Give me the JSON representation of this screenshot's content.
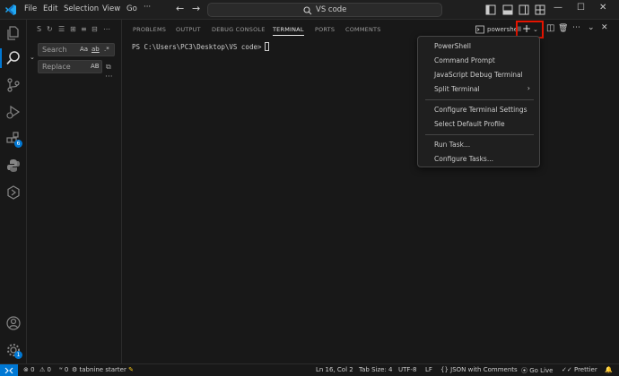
{
  "titlebar": {
    "menus": [
      "File",
      "Edit",
      "Selection",
      "View",
      "Go"
    ],
    "more": "···",
    "search_label": "VS code"
  },
  "activity": {
    "extensions_badge": "6",
    "manage_badge": "1"
  },
  "sidebar": {
    "search_placeholder": "Search",
    "search_case": "Aa",
    "search_word": "ab",
    "search_regex": ".*",
    "replace_placeholder": "Replace",
    "replace_case": "AB",
    "more": "···"
  },
  "panel": {
    "tabs": [
      "PROBLEMS",
      "OUTPUT",
      "DEBUG CONSOLE",
      "TERMINAL",
      "PORTS",
      "COMMENTS"
    ],
    "active_tab": "TERMINAL",
    "shell_label": "powershell",
    "prompt": "PS C:\\Users\\PC3\\Desktop\\VS code>"
  },
  "dropdown": {
    "items": [
      "PowerShell",
      "Command Prompt",
      "JavaScript Debug Terminal",
      "Split Terminal",
      "Configure Terminal Settings",
      "Select Default Profile",
      "Run Task...",
      "Configure Tasks..."
    ]
  },
  "statusbar": {
    "errors": "0",
    "warnings": "0",
    "ports": "0",
    "tabnine": "tabnine starter",
    "position": "Ln 16, Col 2",
    "tab_size": "Tab Size: 4",
    "encoding": "UTF-8",
    "eol": "LF",
    "language": "JSON with Comments",
    "go_live": "Go Live",
    "prettier": "Prettier"
  },
  "colors": {
    "accent": "#0078d4",
    "highlight": "#e51400",
    "background": "#1f1f1f",
    "panel": "#181818"
  }
}
